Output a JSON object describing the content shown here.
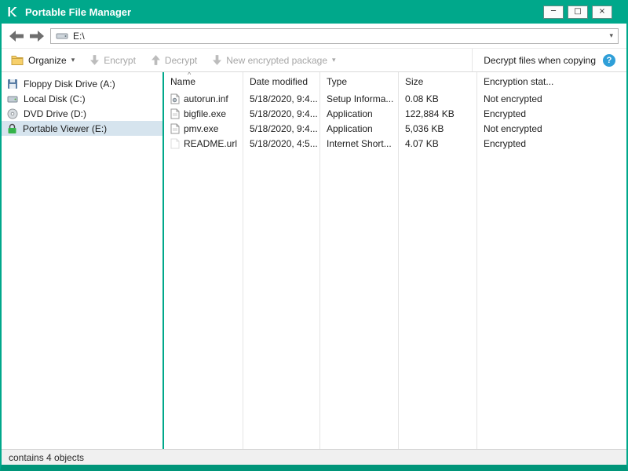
{
  "window": {
    "title": "Portable File Manager",
    "controls": {
      "minimize": "─",
      "maximize": "□",
      "close": "×"
    }
  },
  "navigation": {
    "address": "E:\\"
  },
  "icons": {
    "chevron_down": "▾",
    "sort_caret": "^",
    "help": "?"
  },
  "toolbar": {
    "organize_label": "Organize",
    "encrypt_label": "Encrypt",
    "decrypt_label": "Decrypt",
    "new_package_label": "New encrypted package",
    "decrypt_when_copying_label": "Decrypt files when copying"
  },
  "sidebar": {
    "items": [
      {
        "label": "Floppy Disk Drive (A:)"
      },
      {
        "label": "Local Disk (C:)"
      },
      {
        "label": "DVD Drive (D:)"
      },
      {
        "label": "Portable Viewer (E:)",
        "selected": true
      }
    ]
  },
  "file_list": {
    "columns": [
      "Name",
      "Date modified",
      "Type",
      "Size",
      "Encryption stat..."
    ],
    "rows": [
      {
        "name": "autorun.inf",
        "date": "5/18/2020, 9:4...",
        "type": "Setup Informa...",
        "size": "0.08 KB",
        "encryption": "Not encrypted"
      },
      {
        "name": "bigfile.exe",
        "date": "5/18/2020, 9:4...",
        "type": "Application",
        "size": "122,884 KB",
        "encryption": "Encrypted"
      },
      {
        "name": "pmv.exe",
        "date": "5/18/2020, 9:4...",
        "type": "Application",
        "size": "5,036 KB",
        "encryption": "Not encrypted"
      },
      {
        "name": "README.url",
        "date": "5/18/2020, 4:5...",
        "type": "Internet Short...",
        "size": "4.07 KB",
        "encryption": "Encrypted"
      }
    ]
  },
  "status_bar": {
    "text": "contains 4 objects"
  },
  "colors": {
    "brand_green": "#00a88b",
    "help_blue": "#2f9fd8",
    "selected_item_bg": "#d6e4ee"
  }
}
